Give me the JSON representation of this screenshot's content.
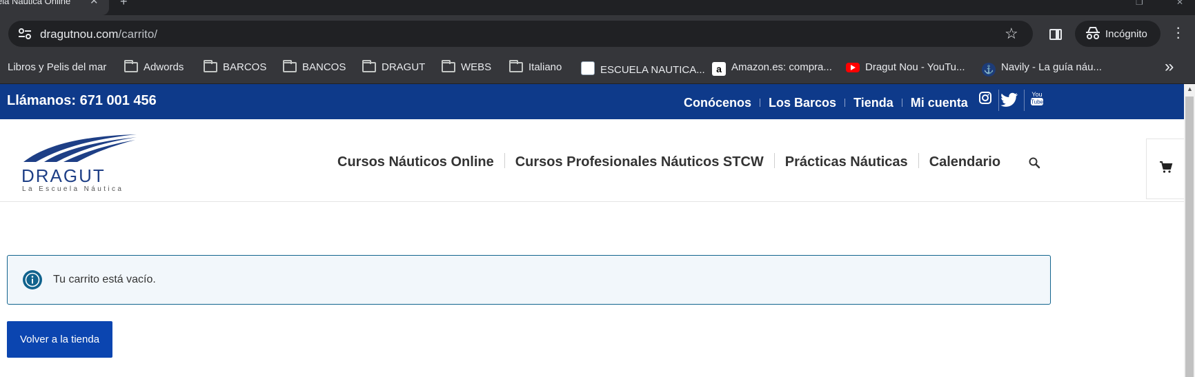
{
  "browser": {
    "tab_title": "ela Náutica Online",
    "url_host": "dragutnou.com",
    "url_path": "/carrito/",
    "incognito_label": "Incógnito",
    "bookmarks": [
      {
        "label": "Libros y Pelis del mar",
        "icon": "folder-icon"
      },
      {
        "label": "Adwords",
        "icon": "folder-icon"
      },
      {
        "label": "BARCOS",
        "icon": "folder-icon"
      },
      {
        "label": "BANCOS",
        "icon": "folder-icon"
      },
      {
        "label": "DRAGUT",
        "icon": "folder-icon"
      },
      {
        "label": "WEBS",
        "icon": "folder-icon"
      },
      {
        "label": "Italiano",
        "icon": "folder-icon"
      },
      {
        "label": "ESCUELA NAUTICA...",
        "icon": "favicon"
      },
      {
        "label": "Amazon.es: compra...",
        "icon": "amazon-icon"
      },
      {
        "label": "Dragut Nou - YouTu...",
        "icon": "youtube-icon"
      },
      {
        "label": "Navily - La guía náu...",
        "icon": "favicon"
      }
    ]
  },
  "site": {
    "colors": {
      "topbar": "#0e3a8a",
      "button": "#0b45b0",
      "notice_border": "#11638d"
    },
    "phone": "Llámanos: 671 001 456",
    "top_links": [
      "Conócenos",
      "Los Barcos",
      "Tienda",
      "Mi cuenta"
    ],
    "social_icons": [
      "instagram-icon",
      "twitter-icon",
      "youtube-icon"
    ],
    "logo": {
      "name": "DRAGUT",
      "tagline": "La Escuela Náutica"
    },
    "nav": [
      "Cursos Náuticos Online",
      "Cursos Profesionales Náuticos STCW",
      "Prácticas Náuticas",
      "Calendario"
    ],
    "cart_notice": "Tu carrito está vacío.",
    "back_button": "Volver a la tienda"
  }
}
